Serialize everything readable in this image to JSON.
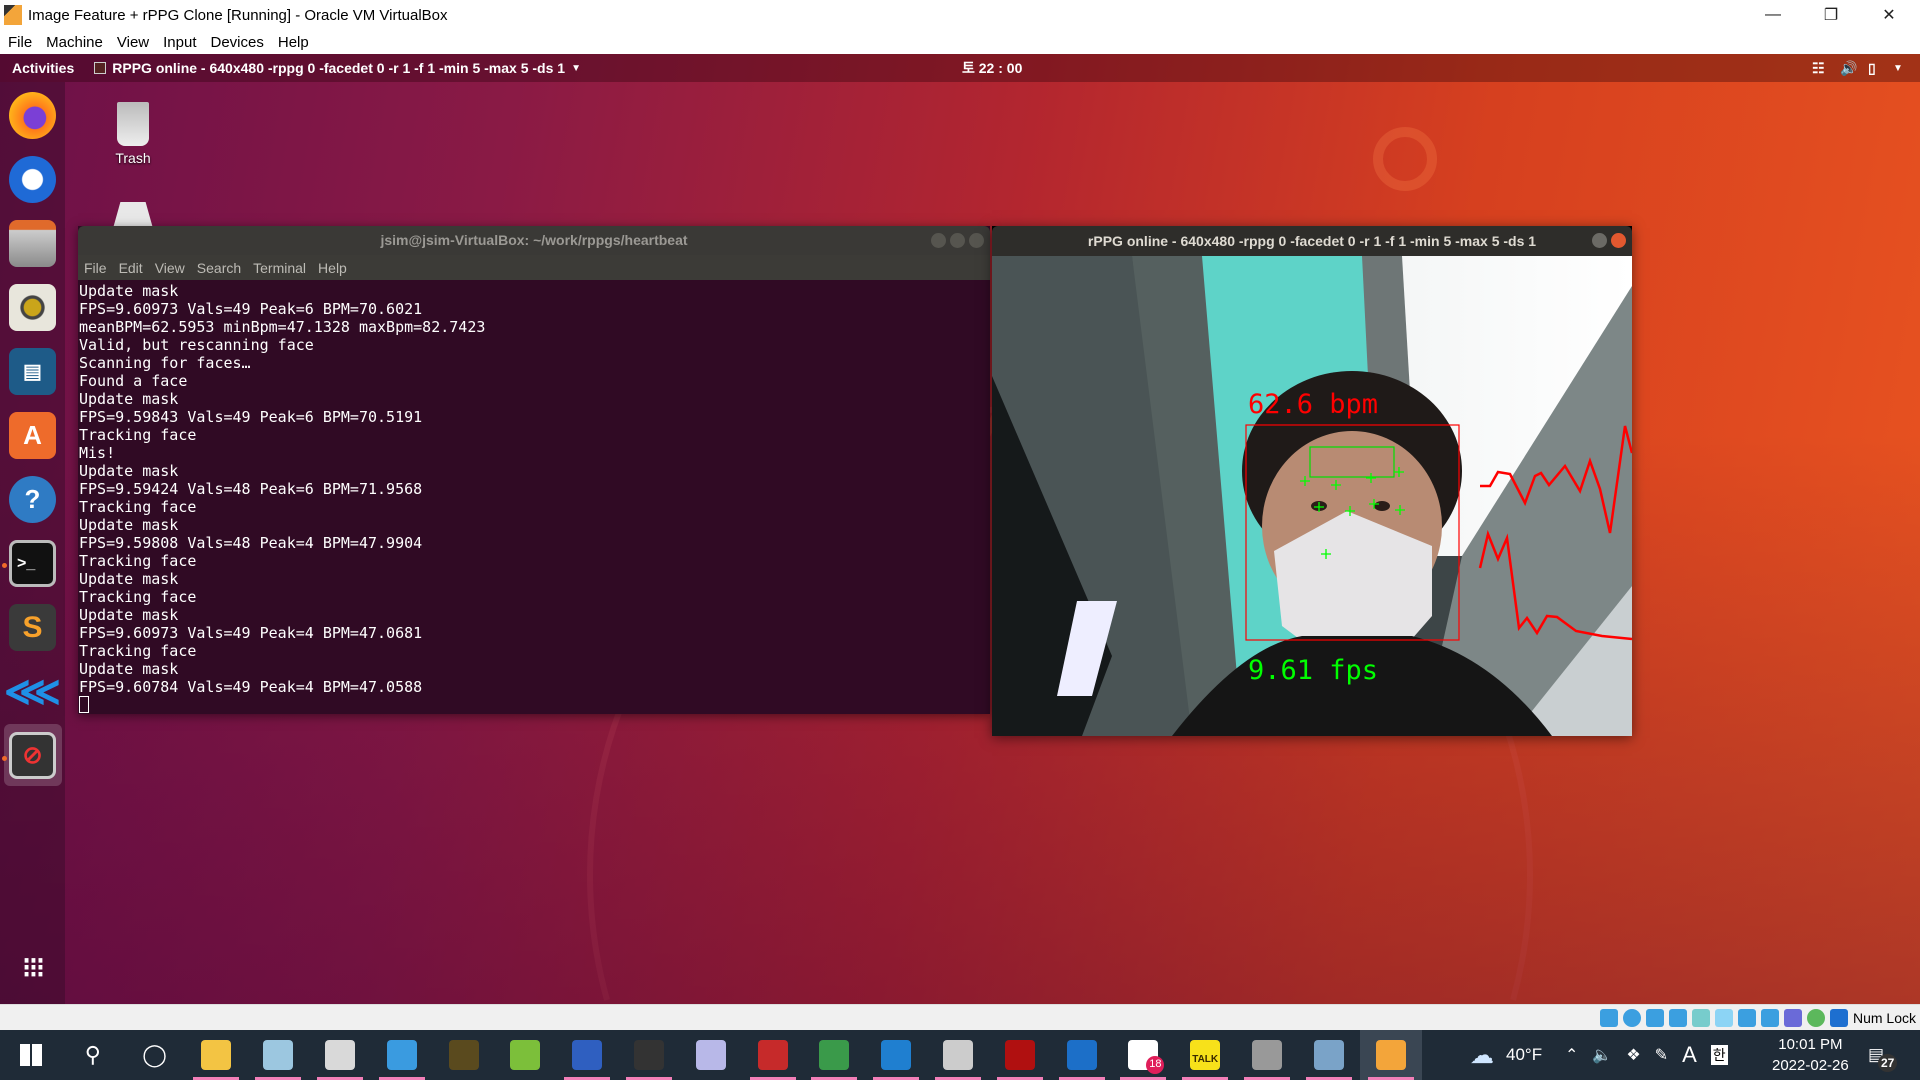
{
  "host": {
    "title": "Image Feature + rPPG Clone [Running] - Oracle VM VirtualBox",
    "menu": [
      "File",
      "Machine",
      "View",
      "Input",
      "Devices",
      "Help"
    ],
    "status_text": "Num Lock"
  },
  "guest": {
    "topbar": {
      "activities": "Activities",
      "app_title": "RPPG online - 640x480 -rppg 0 -facedet 0 -r 1 -f 1 -min 5 -max 5 -ds 1",
      "clock": "토 22 : 00"
    },
    "desktop": {
      "trash_label": "Trash"
    },
    "dock": [
      "firefox-icon",
      "thunderbird-icon",
      "files-icon",
      "rhythmbox-icon",
      "libreoffice-writer-icon",
      "software-center-icon",
      "help-icon",
      "terminal-icon",
      "sublime-text-icon",
      "vscode-icon",
      "rppg-app-icon"
    ],
    "terminal": {
      "title": "jsim@jsim-VirtualBox: ~/work/rppgs/heartbeat",
      "menu": [
        "File",
        "Edit",
        "View",
        "Search",
        "Terminal",
        "Help"
      ],
      "lines": [
        "Update mask",
        "FPS=9.60973 Vals=49 Peak=6 BPM=70.6021",
        "meanBPM=62.5953 minBpm=47.1328 maxBpm=82.7423",
        "Valid, but rescanning face",
        "Scanning for faces…",
        "Found a face",
        "Update mask",
        "FPS=9.59843 Vals=49 Peak=6 BPM=70.5191",
        "Tracking face",
        "Mis!",
        "Update mask",
        "FPS=9.59424 Vals=48 Peak=6 BPM=71.9568",
        "Tracking face",
        "Update mask",
        "FPS=9.59808 Vals=48 Peak=4 BPM=47.9904",
        "Tracking face",
        "Update mask",
        "Tracking face",
        "Update mask",
        "FPS=9.60973 Vals=49 Peak=4 BPM=47.0681",
        "Tracking face",
        "Update mask",
        "FPS=9.60784 Vals=49 Peak=4 BPM=47.0588"
      ]
    },
    "rppg": {
      "title": "rPPG online - 640x480 -rppg 0 -facedet 0 -r 1 -f 1 -min 5 -max 5 -ds 1",
      "bpm": "62.6 bpm",
      "fps": "9.61 fps",
      "colors": {
        "bpm": "#ff0000",
        "fps": "#00ff00",
        "face_box": "#ff0000"
      }
    }
  },
  "taskbar": {
    "weather": "40°F",
    "time": "10:01 PM",
    "date": "2022-02-26",
    "ime_lang": "A",
    "ime_korean": "한",
    "notifications": "27",
    "slack_badge": "18",
    "kakao_label": "TALK",
    "apps": [
      "start-icon",
      "search-icon",
      "cortana-icon",
      "file-explorer-icon",
      "notepad-icon",
      "snipping-tool-icon",
      "control-panel-icon",
      "utility-icon",
      "notepadpp-icon",
      "remote-desktop-icon",
      "cmd-icon",
      "app-icon",
      "zotero-icon",
      "chrome-icon",
      "vscode-icon",
      "monitor-icon",
      "acrobat-icon",
      "reader-icon",
      "slack-icon",
      "kakaotalk-icon",
      "vm-icon",
      "virtualbox-icon",
      "vbox-vm-icon"
    ]
  }
}
